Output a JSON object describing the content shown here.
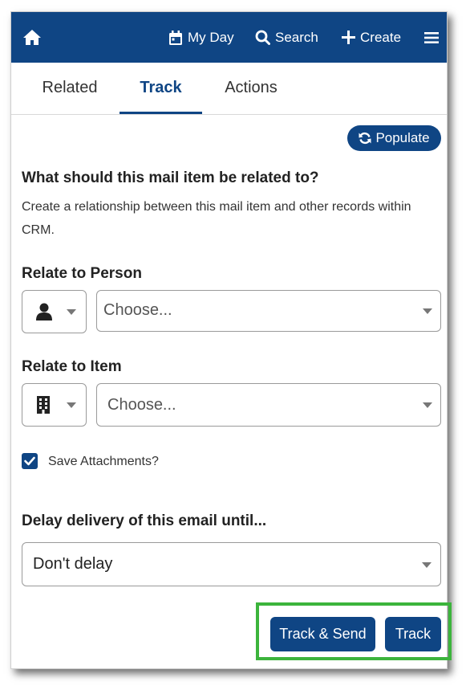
{
  "topbar": {
    "home_icon": "home-icon",
    "my_day_label": "My Day",
    "search_label": "Search",
    "create_label": "Create",
    "menu_icon": "hamburger-menu-icon"
  },
  "tabs": [
    {
      "label": "Related"
    },
    {
      "label": "Track",
      "active": true
    },
    {
      "label": "Actions"
    }
  ],
  "populate_label": "Populate",
  "relate_section": {
    "heading": "What should this mail item be related to?",
    "description": "Create a relationship between this mail item and other records within CRM."
  },
  "relate_person": {
    "label": "Relate to Person",
    "type_icon": "person-icon",
    "placeholder": "Choose..."
  },
  "relate_item": {
    "label": "Relate to Item",
    "type_icon": "building-icon",
    "placeholder": "Choose..."
  },
  "save_attachments": {
    "label": "Save Attachments?",
    "checked": true
  },
  "delay": {
    "label": "Delay delivery of this email until...",
    "value": "Don't delay"
  },
  "actions": {
    "track_send_label": "Track & Send",
    "track_label": "Track"
  },
  "colors": {
    "primary": "#0f4584",
    "highlight": "#3cb43c"
  }
}
